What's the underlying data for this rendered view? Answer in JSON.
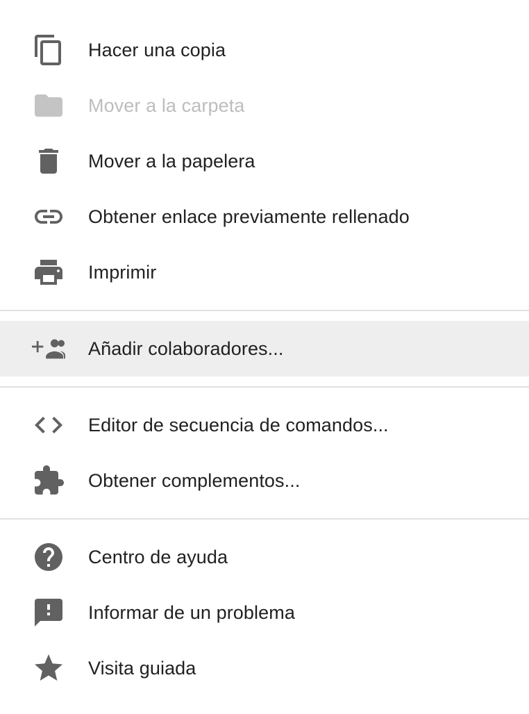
{
  "menu": {
    "items": [
      {
        "label": "Hacer una copia",
        "icon": "copy-icon",
        "disabled": false
      },
      {
        "label": "Mover a la carpeta",
        "icon": "folder-icon",
        "disabled": true
      },
      {
        "label": "Mover a la papelera",
        "icon": "trash-icon",
        "disabled": false
      },
      {
        "label": "Obtener enlace previamente rellenado",
        "icon": "link-icon",
        "disabled": false
      },
      {
        "label": "Imprimir",
        "icon": "print-icon",
        "disabled": false
      },
      {
        "label": "Añadir colaboradores...",
        "icon": "add-people-icon",
        "disabled": false,
        "highlighted": true
      },
      {
        "label": "Editor de secuencia de comandos...",
        "icon": "code-icon",
        "disabled": false
      },
      {
        "label": "Obtener complementos...",
        "icon": "puzzle-icon",
        "disabled": false
      },
      {
        "label": "Centro de ayuda",
        "icon": "help-icon",
        "disabled": false
      },
      {
        "label": "Informar de un problema",
        "icon": "feedback-icon",
        "disabled": false
      },
      {
        "label": "Visita guiada",
        "icon": "star-icon",
        "disabled": false
      }
    ]
  },
  "colors": {
    "text": "#212121",
    "text_disabled": "#bdbdbd",
    "icon": "#616161",
    "icon_disabled": "#c4c4c4",
    "highlight_bg": "#eeeeee",
    "separator": "#e0e0e0"
  }
}
